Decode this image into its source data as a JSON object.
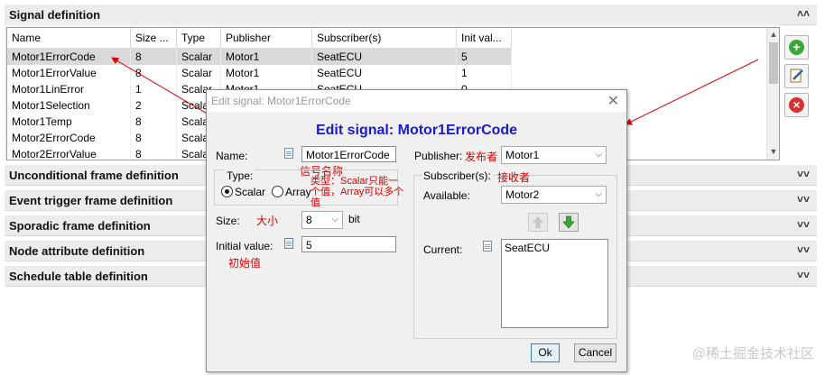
{
  "signal_section": {
    "title": "Signal definition",
    "chevron": "˄˄"
  },
  "table": {
    "headers": [
      "Name",
      "Size ...",
      "Type",
      "Publisher",
      "Subscriber(s)",
      "Init val..."
    ],
    "rows": [
      [
        "Motor1ErrorCode",
        "8",
        "Scalar",
        "Motor1",
        "SeatECU",
        "5"
      ],
      [
        "Motor1ErrorValue",
        "8",
        "Scalar",
        "Motor1",
        "SeatECU",
        "1"
      ],
      [
        "Motor1LinError",
        "1",
        "Scalar",
        "Motor1",
        "SeatECU",
        "0"
      ],
      [
        "Motor1Selection",
        "2",
        "Scalar",
        "",
        "",
        ""
      ],
      [
        "Motor1Temp",
        "8",
        "Scalar",
        "",
        "",
        ""
      ],
      [
        "Motor2ErrorCode",
        "8",
        "Scalar",
        "",
        "",
        ""
      ],
      [
        "Motor2ErrorValue",
        "8",
        "Scalar",
        "",
        "",
        ""
      ]
    ]
  },
  "sections": [
    {
      "title": "Unconditional frame definition",
      "chevron": "˅˅"
    },
    {
      "title": "Event trigger frame definition",
      "chevron": "˅˅"
    },
    {
      "title": "Sporadic frame definition",
      "chevron": "˅˅"
    },
    {
      "title": "Node attribute definition",
      "chevron": "˅˅"
    },
    {
      "title": "Schedule table definition",
      "chevron": "˅˅"
    }
  ],
  "side_buttons": [
    "add-icon",
    "edit-icon",
    "delete-icon"
  ],
  "dialog": {
    "window_title": "Edit signal: Motor1ErrorCode",
    "heading": "Edit signal: Motor1ErrorCode",
    "name_label": "Name:",
    "name_value": "Motor1ErrorCode",
    "name_note": "信号名称",
    "type_group_label": "Type:",
    "type_scalar": "Scalar",
    "type_array": "Array",
    "type_note_line1": "类型：Scalar只能一",
    "type_note_line2": "个值，Array可以多个",
    "type_note_line3": "值",
    "size_label": "Size:",
    "size_note": "大小",
    "size_value": "8",
    "size_unit": "bit",
    "init_label": "Initial value:",
    "init_value": "5",
    "init_note": "初始值",
    "publisher_label": "Publisher:",
    "publisher_note": "发布者",
    "publisher_value": "Motor1",
    "subscribers_label": "Subscriber(s):",
    "subscribers_note": "接收者",
    "available_label": "Available:",
    "available_value": "Motor2",
    "current_label": "Current:",
    "current_items": [
      "SeatECU"
    ],
    "ok_label": "Ok",
    "cancel_label": "Cancel",
    "close_glyph": "✕"
  },
  "watermark": "@稀土掘金技术社区",
  "colors": {
    "heading_blue": "#1a1acc",
    "annotation_red": "#e00000",
    "add_green": "#3aa83a",
    "delete_red": "#d93030"
  }
}
